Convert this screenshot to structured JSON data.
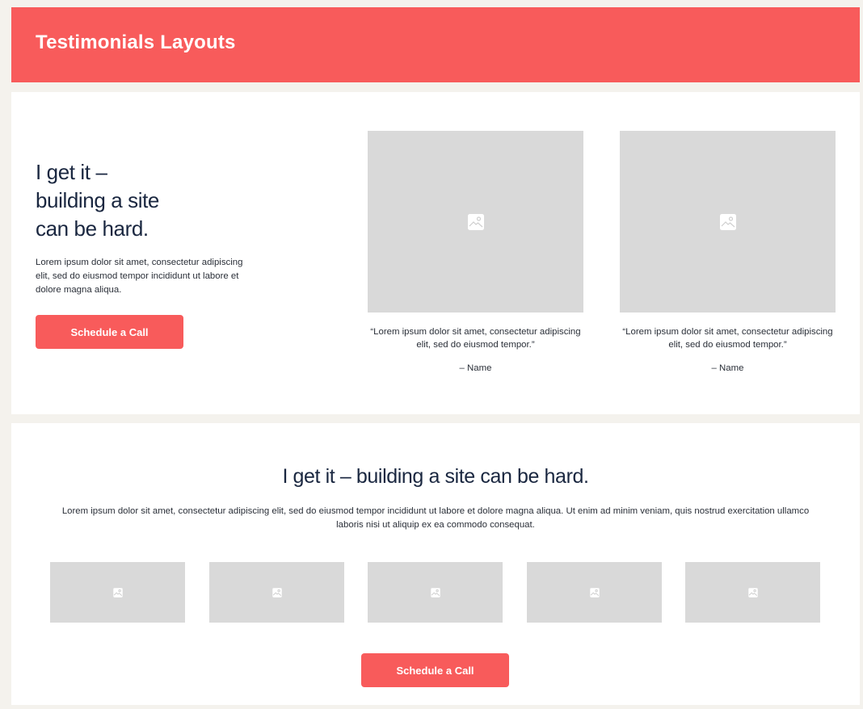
{
  "header": {
    "title": "Testimonials Layouts"
  },
  "hero": {
    "heading_lines": [
      "I get it –",
      "building a site",
      "can be hard."
    ],
    "body": "Lorem ipsum dolor sit amet, consectetur adipiscing elit, sed do eiusmod tempor incididunt ut labore et dolore magna aliqua.",
    "button_label": "Schedule a Call"
  },
  "testimonials": [
    {
      "image_icon": "image-icon",
      "quote": "“Lorem ipsum dolor sit amet, consectetur adipiscing elit, sed do eiusmod tempor.”",
      "author": "– Name"
    },
    {
      "image_icon": "image-icon",
      "quote": "“Lorem ipsum dolor sit amet, consectetur adipiscing elit, sed do eiusmod tempor.”",
      "author": "– Name"
    }
  ],
  "section": {
    "heading": "I get it – building a site can be hard.",
    "body": "Lorem ipsum dolor sit amet, consectetur adipiscing elit, sed do eiusmod tempor incididunt ut labore et dolore magna aliqua. Ut enim ad minim veniam, quis nostrud exercitation ullamco laboris nisi ut aliquip ex ea commodo consequat.",
    "logo_count_icon": "image-icon",
    "button_label": "Schedule a Call"
  },
  "colors": {
    "accent": "#f85b5b",
    "background": "#f4f2ed",
    "panel": "#ffffff",
    "placeholder": "#d9d9d9",
    "heading": "#1a2740"
  }
}
